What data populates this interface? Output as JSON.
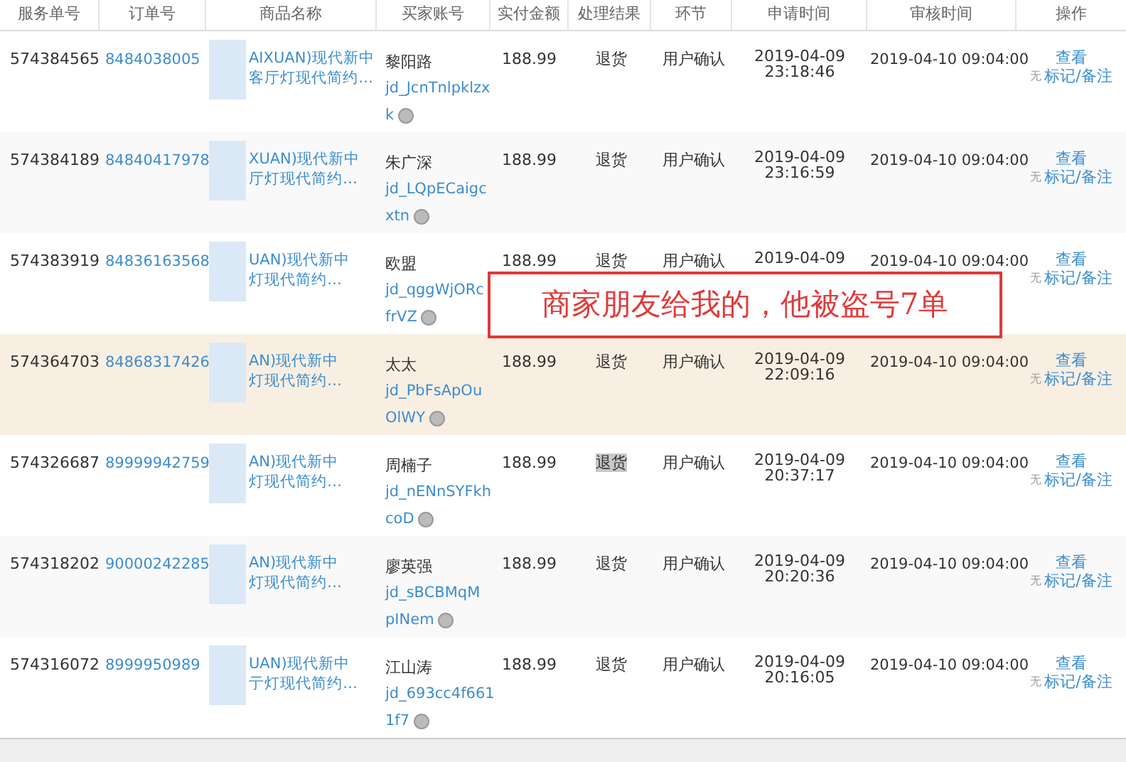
{
  "table": {
    "columns": [
      "服务单号",
      "订单号",
      "商品名称",
      "买家账号",
      "实付金额",
      "处理结果",
      "环节",
      "申请时间",
      "审核时间",
      "操作"
    ],
    "rows": [
      {
        "service_no": "574384565",
        "order_no": "8484038005",
        "product": [
          "AIXUAN)现代新中",
          "客厅灯现代简约…"
        ],
        "buyer_name": "黎阳路",
        "buyer_id": [
          "jd_JcnTnlpklzx",
          "k"
        ],
        "amount": "188.99",
        "result": "退货",
        "result_highlighted": false,
        "stage": "用户确认",
        "apply_time": [
          "2019-04-09",
          "23:18:46"
        ],
        "review_time": "2019-04-10 09:04:00",
        "action_view": "查看",
        "action_none": "无",
        "action_mark": "标记/备注",
        "hovered": false
      },
      {
        "service_no": "574384189",
        "order_no": "84840417978",
        "product": [
          "XUAN)现代新中",
          "厅灯现代简约…"
        ],
        "buyer_name": "朱广深",
        "buyer_id": [
          "jd_LQpECaigc",
          "xtn"
        ],
        "amount": "188.99",
        "result": "退货",
        "result_highlighted": false,
        "stage": "用户确认",
        "apply_time": [
          "2019-04-09",
          "23:16:59"
        ],
        "review_time": "2019-04-10 09:04:00",
        "action_view": "查看",
        "action_none": "无",
        "action_mark": "标记/备注",
        "hovered": false
      },
      {
        "service_no": "574383919",
        "order_no": "84836163568",
        "product": [
          "UAN)现代新中",
          "灯现代简约…"
        ],
        "buyer_name": "欧盟",
        "buyer_id": [
          "jd_qggWjORc",
          "frVZ"
        ],
        "amount": "188.99",
        "result": "退货",
        "result_highlighted": false,
        "stage": "用户确认",
        "apply_time": [
          "2019-04-09"
        ],
        "review_time": "2019-04-10 09:04:00",
        "action_view": "查看",
        "action_none": "无",
        "action_mark": "标记/备注",
        "hovered": false
      },
      {
        "service_no": "574364703",
        "order_no": "84868317426",
        "product": [
          "AN)现代新中",
          "灯现代简约…"
        ],
        "buyer_name": "太太",
        "buyer_id": [
          "jd_PbFsApOu",
          "OlWY"
        ],
        "amount": "188.99",
        "result": "退货",
        "result_highlighted": false,
        "stage": "用户确认",
        "apply_time": [
          "2019-04-09",
          "22:09:16"
        ],
        "review_time": "2019-04-10 09:04:00",
        "action_view": "查看",
        "action_none": "无",
        "action_mark": "标记/备注",
        "hovered": true
      },
      {
        "service_no": "574326687",
        "order_no": "89999942759",
        "product": [
          "AN)现代新中",
          "灯现代简约…"
        ],
        "buyer_name": "周楠子",
        "buyer_id": [
          "jd_nENnSYFkh",
          "coD"
        ],
        "amount": "188.99",
        "result": "退货",
        "result_highlighted": true,
        "stage": "用户确认",
        "apply_time": [
          "2019-04-09",
          "20:37:17"
        ],
        "review_time": "2019-04-10 09:04:00",
        "action_view": "查看",
        "action_none": "无",
        "action_mark": "标记/备注",
        "hovered": false
      },
      {
        "service_no": "574318202",
        "order_no": "90000242285",
        "product": [
          "AN)现代新中",
          "灯现代简约…"
        ],
        "buyer_name": "廖英强",
        "buyer_id": [
          "jd_sBCBMqM",
          "pINem"
        ],
        "amount": "188.99",
        "result": "退货",
        "result_highlighted": false,
        "stage": "用户确认",
        "apply_time": [
          "2019-04-09",
          "20:20:36"
        ],
        "review_time": "2019-04-10 09:04:00",
        "action_view": "查看",
        "action_none": "无",
        "action_mark": "标记/备注",
        "hovered": false
      },
      {
        "service_no": "574316072",
        "order_no": "8999950989",
        "product": [
          "UAN)现代新中",
          "亍灯现代简约…"
        ],
        "buyer_name": "江山涛",
        "buyer_id": [
          "jd_693cc4f661",
          "1f7"
        ],
        "amount": "188.99",
        "result": "退货",
        "result_highlighted": false,
        "stage": "用户确认",
        "apply_time": [
          "2019-04-09",
          "20:16:05"
        ],
        "review_time": "2019-04-10 09:04:00",
        "action_view": "查看",
        "action_none": "无",
        "action_mark": "标记/备注",
        "hovered": false
      }
    ]
  },
  "annotation": {
    "text": "商家朋友给我的，他被盗号7单"
  }
}
